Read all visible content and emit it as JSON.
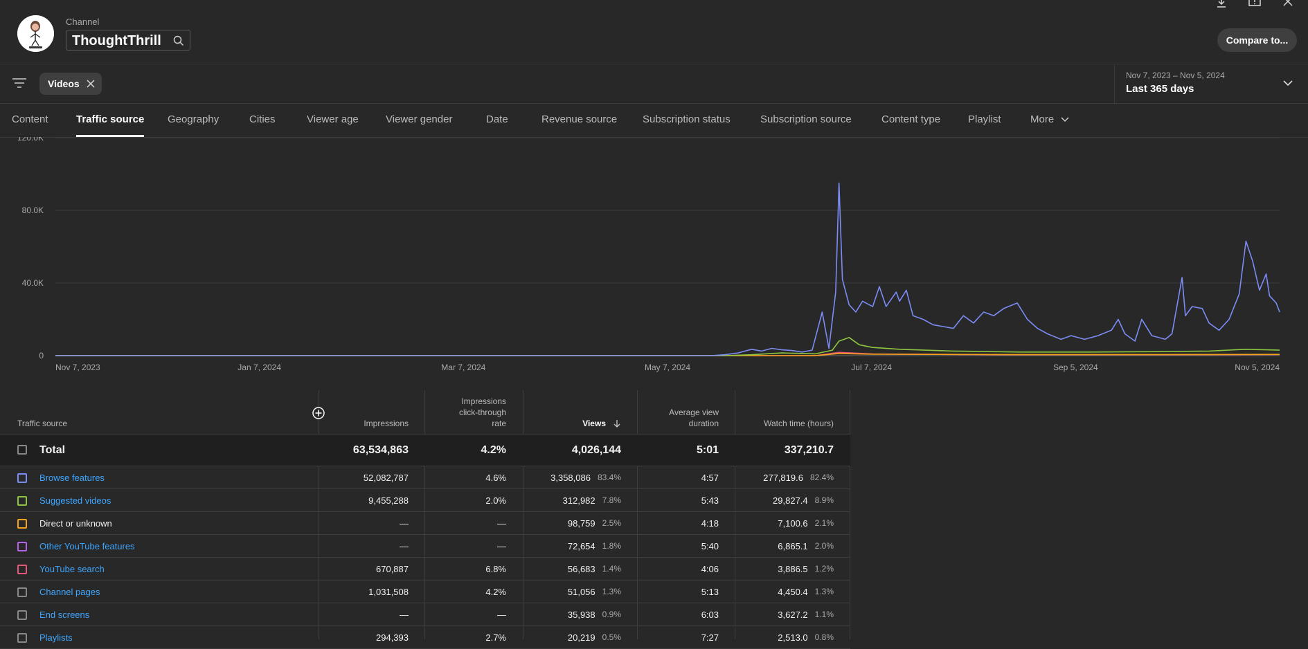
{
  "header": {
    "channel_label": "Channel",
    "channel_name": "ThoughtThrill",
    "compare_label": "Compare to..."
  },
  "filters": {
    "chip_label": "Videos",
    "date_range": "Nov 7, 2023 – Nov 5, 2024",
    "date_label": "Last 365 days"
  },
  "tabs": [
    {
      "label": "Content"
    },
    {
      "label": "Traffic source",
      "active": true
    },
    {
      "label": "Geography"
    },
    {
      "label": "Cities"
    },
    {
      "label": "Viewer age"
    },
    {
      "label": "Viewer gender"
    },
    {
      "label": "Date"
    },
    {
      "label": "Revenue source"
    },
    {
      "label": "Subscription status"
    },
    {
      "label": "Subscription source"
    },
    {
      "label": "Content type"
    },
    {
      "label": "Playlist"
    },
    {
      "label": "More"
    }
  ],
  "chart_data": {
    "type": "line",
    "x_tick_labels": [
      "Nov 7, 2023",
      "Jan 7, 2024",
      "Mar 7, 2024",
      "May 7, 2024",
      "Jul 7, 2024",
      "Sep 5, 2024",
      "Nov 5, 2024"
    ],
    "y_tick_labels": [
      "0",
      "40.0K",
      "80.0K",
      "120.0K"
    ],
    "ylim": [
      0,
      120000
    ],
    "x_range": [
      "2023-11-07",
      "2024-11-05"
    ],
    "grid": true,
    "series": [
      {
        "name": "Browse features",
        "color": "#7b8cf5",
        "points": [
          [
            "2023-11-07",
            0
          ],
          [
            "2024-05-20",
            0
          ],
          [
            "2024-05-24",
            500
          ],
          [
            "2024-05-28",
            1500
          ],
          [
            "2024-06-01",
            3500
          ],
          [
            "2024-06-04",
            2500
          ],
          [
            "2024-06-07",
            4000
          ],
          [
            "2024-06-10",
            3200
          ],
          [
            "2024-06-13",
            2800
          ],
          [
            "2024-06-16",
            2000
          ],
          [
            "2024-06-19",
            3000
          ],
          [
            "2024-06-22",
            24000
          ],
          [
            "2024-06-24",
            4000
          ],
          [
            "2024-06-26",
            35000
          ],
          [
            "2024-06-27",
            95000
          ],
          [
            "2024-06-28",
            42000
          ],
          [
            "2024-06-30",
            28000
          ],
          [
            "2024-07-02",
            24000
          ],
          [
            "2024-07-04",
            30000
          ],
          [
            "2024-07-07",
            27000
          ],
          [
            "2024-07-09",
            38000
          ],
          [
            "2024-07-11",
            27000
          ],
          [
            "2024-07-14",
            35000
          ],
          [
            "2024-07-15",
            30000
          ],
          [
            "2024-07-17",
            36000
          ],
          [
            "2024-07-19",
            22000
          ],
          [
            "2024-07-22",
            20000
          ],
          [
            "2024-07-25",
            17000
          ],
          [
            "2024-07-28",
            16000
          ],
          [
            "2024-07-31",
            15000
          ],
          [
            "2024-08-03",
            22000
          ],
          [
            "2024-08-06",
            18000
          ],
          [
            "2024-08-09",
            24000
          ],
          [
            "2024-08-12",
            22000
          ],
          [
            "2024-08-15",
            26000
          ],
          [
            "2024-08-19",
            29000
          ],
          [
            "2024-08-22",
            20000
          ],
          [
            "2024-08-25",
            15000
          ],
          [
            "2024-08-28",
            12000
          ],
          [
            "2024-09-01",
            9000
          ],
          [
            "2024-09-04",
            11000
          ],
          [
            "2024-09-08",
            9000
          ],
          [
            "2024-09-12",
            11000
          ],
          [
            "2024-09-16",
            14000
          ],
          [
            "2024-09-18",
            20000
          ],
          [
            "2024-09-20",
            12000
          ],
          [
            "2024-09-23",
            8000
          ],
          [
            "2024-09-25",
            20000
          ],
          [
            "2024-09-28",
            11000
          ],
          [
            "2024-10-02",
            9000
          ],
          [
            "2024-10-04",
            12000
          ],
          [
            "2024-10-07",
            43000
          ],
          [
            "2024-10-08",
            22000
          ],
          [
            "2024-10-10",
            27000
          ],
          [
            "2024-10-13",
            26000
          ],
          [
            "2024-10-15",
            18000
          ],
          [
            "2024-10-18",
            14000
          ],
          [
            "2024-10-21",
            20000
          ],
          [
            "2024-10-24",
            34000
          ],
          [
            "2024-10-26",
            63000
          ],
          [
            "2024-10-28",
            52000
          ],
          [
            "2024-10-30",
            36000
          ],
          [
            "2024-11-01",
            45000
          ],
          [
            "2024-11-02",
            33000
          ],
          [
            "2024-11-04",
            29000
          ],
          [
            "2024-11-05",
            24000
          ]
        ]
      },
      {
        "name": "Suggested videos",
        "color": "#8ec63f",
        "points": [
          [
            "2023-11-07",
            0
          ],
          [
            "2024-05-24",
            0
          ],
          [
            "2024-06-01",
            500
          ],
          [
            "2024-06-10",
            1500
          ],
          [
            "2024-06-20",
            1000
          ],
          [
            "2024-06-25",
            3000
          ],
          [
            "2024-06-27",
            8000
          ],
          [
            "2024-06-30",
            10000
          ],
          [
            "2024-07-03",
            6000
          ],
          [
            "2024-07-07",
            4500
          ],
          [
            "2024-07-15",
            3500
          ],
          [
            "2024-07-31",
            2500
          ],
          [
            "2024-08-20",
            2000
          ],
          [
            "2024-09-10",
            2000
          ],
          [
            "2024-09-30",
            2200
          ],
          [
            "2024-10-15",
            2500
          ],
          [
            "2024-10-26",
            3500
          ],
          [
            "2024-11-05",
            3000
          ]
        ]
      },
      {
        "name": "Direct or unknown",
        "color": "#f7a21b",
        "points": [
          [
            "2023-11-07",
            0
          ],
          [
            "2024-06-20",
            0
          ],
          [
            "2024-06-27",
            1200
          ],
          [
            "2024-07-07",
            800
          ],
          [
            "2024-08-15",
            600
          ],
          [
            "2024-09-30",
            600
          ],
          [
            "2024-11-05",
            700
          ]
        ]
      },
      {
        "name": "YouTube search",
        "color": "#e8567a",
        "points": [
          [
            "2023-11-07",
            0
          ],
          [
            "2024-06-20",
            0
          ],
          [
            "2024-06-27",
            1800
          ],
          [
            "2024-07-07",
            900
          ],
          [
            "2024-08-15",
            500
          ],
          [
            "2024-09-30",
            500
          ],
          [
            "2024-11-05",
            600
          ]
        ]
      }
    ]
  },
  "table": {
    "headers": {
      "source": "Traffic source",
      "impressions": "Impressions",
      "ctr_l1": "Impressions",
      "ctr_l2": "click-through",
      "ctr_l3": "rate",
      "views": "Views",
      "avd_l1": "Average view",
      "avd_l2": "duration",
      "watch": "Watch time (hours)"
    },
    "total": {
      "label": "Total",
      "impressions": "63,534,863",
      "ctr": "4.2%",
      "views": "4,026,144",
      "avd": "5:01",
      "watch": "337,210.7"
    },
    "rows": [
      {
        "label": "Browse features",
        "color": "#7b8cf5",
        "link": true,
        "impressions": "52,082,787",
        "ctr": "4.6%",
        "views": "3,358,086",
        "views_pct": "83.4%",
        "avd": "4:57",
        "watch": "277,819.6",
        "watch_pct": "82.4%"
      },
      {
        "label": "Suggested videos",
        "color": "#8ec63f",
        "link": true,
        "impressions": "9,455,288",
        "ctr": "2.0%",
        "views": "312,982",
        "views_pct": "7.8%",
        "avd": "5:43",
        "watch": "29,827.4",
        "watch_pct": "8.9%"
      },
      {
        "label": "Direct or unknown",
        "color": "#f7a21b",
        "link": false,
        "impressions": "—",
        "ctr": "—",
        "views": "98,759",
        "views_pct": "2.5%",
        "avd": "4:18",
        "watch": "7,100.6",
        "watch_pct": "2.1%"
      },
      {
        "label": "Other YouTube features",
        "color": "#b562e8",
        "link": true,
        "impressions": "—",
        "ctr": "—",
        "views": "72,654",
        "views_pct": "1.8%",
        "avd": "5:40",
        "watch": "6,865.1",
        "watch_pct": "2.0%"
      },
      {
        "label": "YouTube search",
        "color": "#e8567a",
        "link": true,
        "impressions": "670,887",
        "ctr": "6.8%",
        "views": "56,683",
        "views_pct": "1.4%",
        "avd": "4:06",
        "watch": "3,886.5",
        "watch_pct": "1.2%"
      },
      {
        "label": "Channel pages",
        "color": "#888888",
        "link": true,
        "impressions": "1,031,508",
        "ctr": "4.2%",
        "views": "51,056",
        "views_pct": "1.3%",
        "avd": "5:13",
        "watch": "4,450.4",
        "watch_pct": "1.3%"
      },
      {
        "label": "End screens",
        "color": "#888888",
        "link": true,
        "impressions": "—",
        "ctr": "—",
        "views": "35,938",
        "views_pct": "0.9%",
        "avd": "6:03",
        "watch": "3,627.2",
        "watch_pct": "1.1%"
      },
      {
        "label": "Playlists",
        "color": "#888888",
        "link": true,
        "impressions": "294,393",
        "ctr": "2.7%",
        "views": "20,219",
        "views_pct": "0.5%",
        "avd": "7:27",
        "watch": "2,513.0",
        "watch_pct": "0.8%"
      }
    ]
  },
  "icons": {
    "search": "search-icon",
    "filter": "filter-icon",
    "close": "close-icon",
    "chevron": "chevron-down-icon",
    "download": "download-icon",
    "feedback": "feedback-icon",
    "add_metric": "add-metric-icon",
    "sort": "sort-down-icon"
  }
}
